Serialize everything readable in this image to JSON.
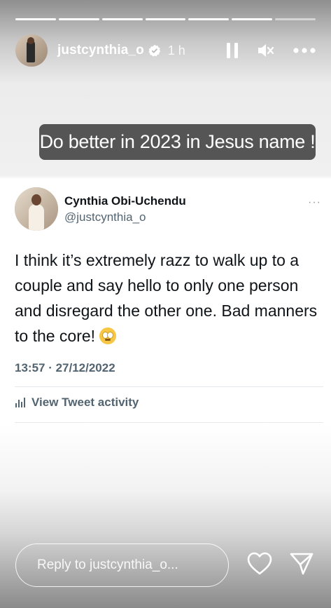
{
  "story": {
    "progress_segments": 7,
    "progress_done": 6,
    "username": "justcynthia_o",
    "time_ago": "1 h",
    "caption": "Do better in 2023 in Jesus name !"
  },
  "icons": {
    "verified": "verified-badge-icon",
    "pause": "pause-icon",
    "mute": "mute-icon",
    "more": "more-icon",
    "like": "heart-icon",
    "share": "send-icon"
  },
  "tweet": {
    "name": "Cynthia Obi-Uchendu",
    "handle": "@justcynthia_o",
    "more": "···",
    "text": "I think it’s extremely razz to walk up to a couple and say hello to only one person and disregard the other one. Bad manners to the core! ",
    "timestamp": "13:57 · 27/12/2022",
    "activity_label": "View Tweet activity"
  },
  "footer": {
    "reply_placeholder": "Reply to justcynthia_o..."
  }
}
